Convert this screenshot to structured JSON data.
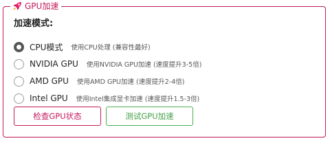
{
  "panel": {
    "title": "GPU加速",
    "title_icon": "rocket-icon",
    "accent_color": "#c2185b"
  },
  "mode_label": "加速模式:",
  "options": [
    {
      "name": "CPU模式",
      "desc": "使用CPU处理 (兼容性最好)",
      "checked": true
    },
    {
      "name": "NVIDIA GPU",
      "desc": "使用NVIDIA GPU加速 (速度提升3-5倍)",
      "checked": false
    },
    {
      "name": "AMD GPU",
      "desc": "使用AMD GPU加速 (速度提升2-4倍)",
      "checked": false
    },
    {
      "name": "Intel GPU",
      "desc": "使用Intel集成显卡加速 (速度提升1.5-3倍)",
      "checked": false
    }
  ],
  "buttons": {
    "check_label": "检查GPU状态",
    "test_label": "测试GPU加速",
    "check_color": "#c2185b",
    "test_color": "#43a047"
  }
}
